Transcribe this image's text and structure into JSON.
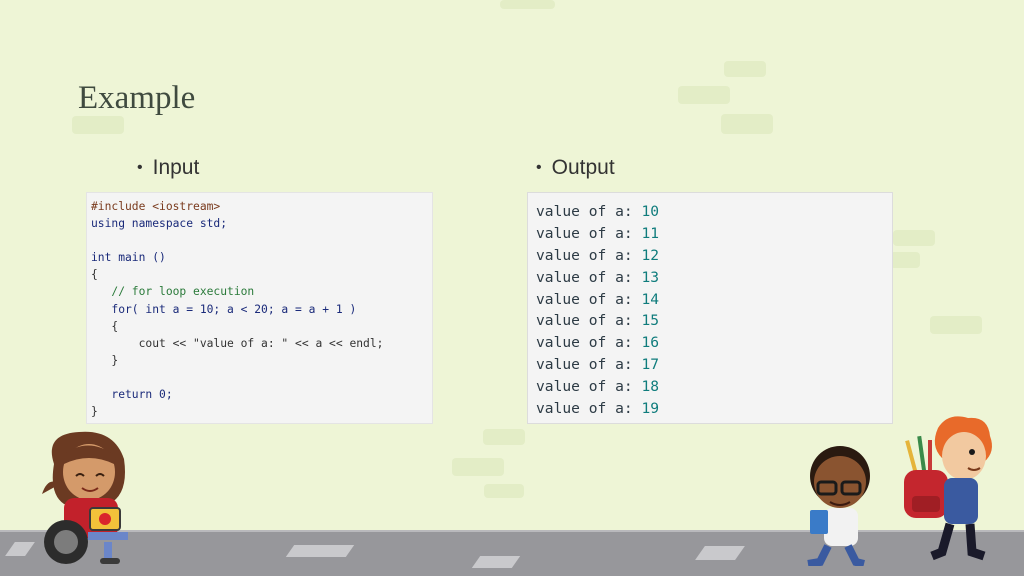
{
  "slide": {
    "title": "Example",
    "input_heading": "Input",
    "output_heading": "Output",
    "bullet": "•"
  },
  "input_code": {
    "lines": [
      "#include <iostream>",
      "using namespace std;",
      "",
      "int main ()",
      "{",
      "   // for loop execution",
      "   for( int a = 10; a < 20; a = a + 1 )",
      "   {",
      "       cout << \"value of a: \" << a << endl;",
      "   }",
      "",
      "   return 0;",
      "}"
    ]
  },
  "output": {
    "prefix": "value of a: ",
    "values": [
      "10",
      "11",
      "12",
      "13",
      "14",
      "15",
      "16",
      "17",
      "18",
      "19"
    ]
  },
  "colors": {
    "background": "#eef5d6",
    "code_bg": "#f4f4f4",
    "number": "#0f7c7c",
    "ground": "#97979b"
  },
  "illustrations": {
    "left": "girl-in-wheelchair-illustration",
    "middle": "boy-with-glasses-illustration",
    "right": "boy-with-backpack-illustration"
  }
}
